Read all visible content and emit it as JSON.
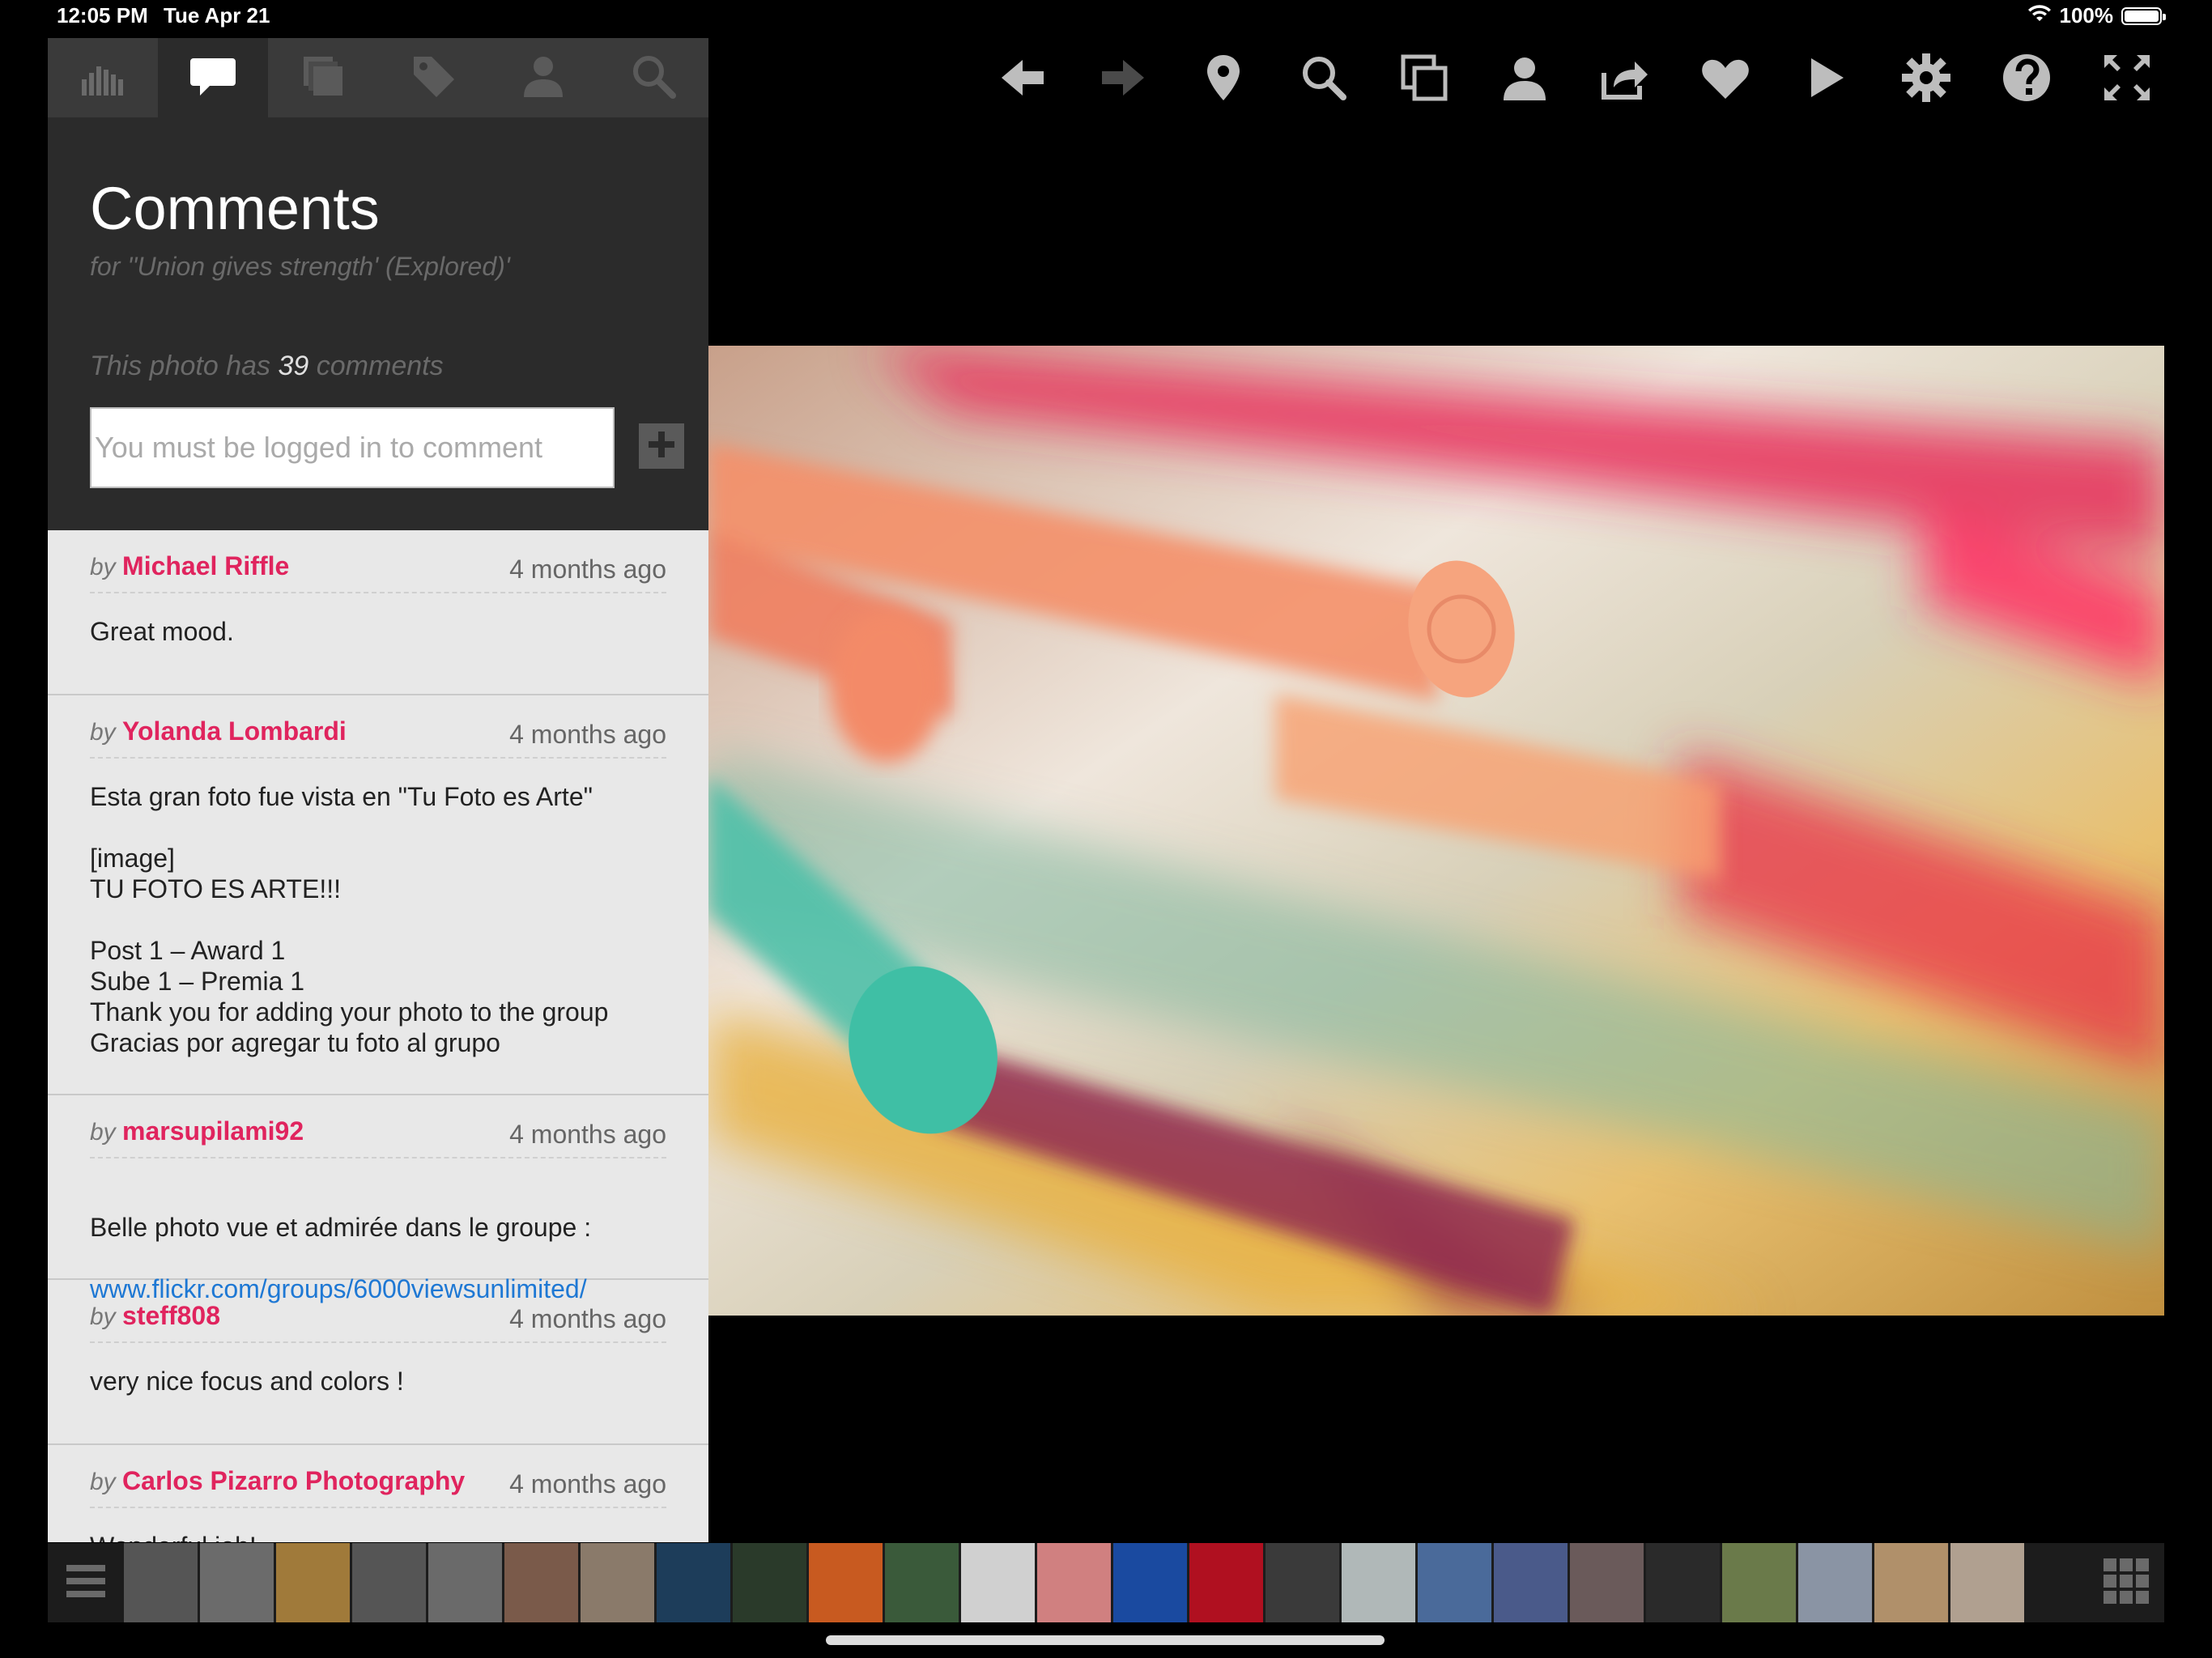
{
  "status": {
    "time": "12:05 PM",
    "date": "Tue Apr 21",
    "battery": "100%",
    "wifi_icon": "wifi-icon",
    "battery_icon": "battery-icon"
  },
  "panel": {
    "tabs": [
      {
        "icon": "stats-icon",
        "active": false
      },
      {
        "icon": "comments-icon",
        "active": true
      },
      {
        "icon": "sets-icon",
        "active": false
      },
      {
        "icon": "tag-icon",
        "active": false
      },
      {
        "icon": "person-icon",
        "active": false
      },
      {
        "icon": "search-icon",
        "active": false
      }
    ],
    "title": "Comments",
    "subtitle": "for ''Union gives strength' (Explored)'",
    "count_prefix": "This photo has",
    "count": "39",
    "count_suffix": "comments",
    "input_placeholder": "You must be logged in to comment",
    "add_icon": "plus-icon"
  },
  "comments": [
    {
      "by": "by",
      "author": "Michael Riffle",
      "time": "4 months ago",
      "body": "Great mood."
    },
    {
      "by": "by",
      "author": "Yolanda Lombardi",
      "time": "4 months ago",
      "body": "Esta gran foto fue vista en \"Tu Foto es Arte\"\n\n[image]\nTU FOTO ES ARTE!!!\n\nPost 1 – Award 1\nSube 1 – Premia 1\nThank you for adding your photo to the group\nGracias por agregar tu foto al grupo"
    },
    {
      "by": "by",
      "author": "marsupilami92",
      "time": "4 months ago",
      "body": "Belle photo vue et admirée dans le groupe :",
      "link": "www.flickr.com/groups/6000viewsunlimited/"
    },
    {
      "by": "by",
      "author": "steff808",
      "time": "4 months ago",
      "body": "very nice focus and colors !"
    },
    {
      "by": "by",
      "author": "Carlos Pizarro Photography",
      "time": "4 months ago",
      "body": "Wonderful job!"
    }
  ],
  "toolbar": [
    "arrow-left-icon",
    "arrow-right-icon",
    "location-pin-icon",
    "search-icon",
    "copy-icon",
    "person-icon",
    "share-icon",
    "heart-icon",
    "play-icon",
    "gear-icon",
    "help-icon",
    "fullscreen-icon"
  ],
  "colors": {
    "accent": "#e0245e",
    "link": "#1e78d4",
    "panel_bg": "#2b2b2b",
    "comment_bg": "#e8e8e8"
  },
  "filmstrip": {
    "menu_icon": "hamburger-menu-icon",
    "grid_icon": "grid-icon",
    "thumb_colors": [
      "#555",
      "#6b6b6b",
      "#a07a3a",
      "#555",
      "#6a6a6a",
      "#7a5a4a",
      "#8a7a6a",
      "#1d3d5a",
      "#2a3a2a",
      "#c85a20",
      "#3a5a3a",
      "#d0d0d0",
      "#d08080",
      "#1a4aa0",
      "#b01020",
      "#3a3a3a",
      "#b0b8b8",
      "#4a6a9a",
      "#4a5a8a",
      "#6a5a5a",
      "#2a2a2a",
      "#6a7a4a",
      "#8a94a4",
      "#b0906a",
      "#b0a090"
    ]
  }
}
